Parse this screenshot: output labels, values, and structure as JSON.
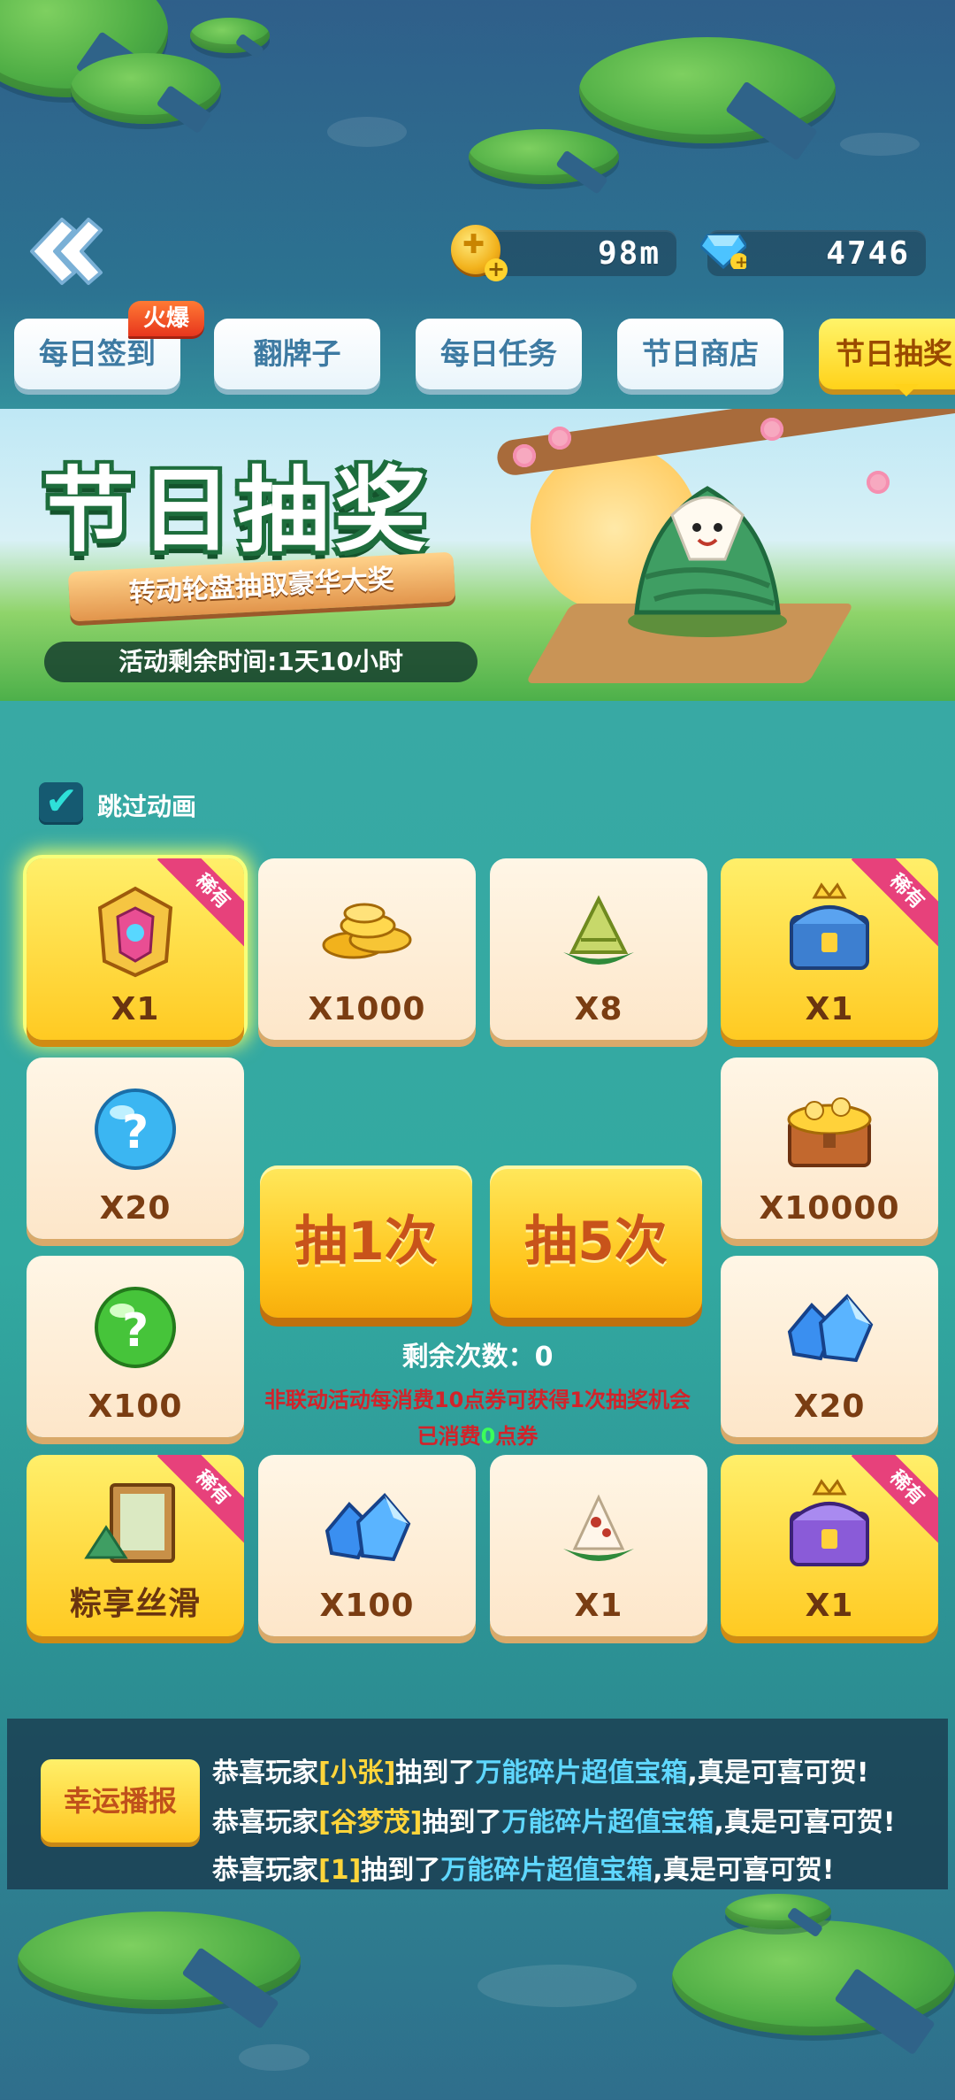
{
  "currency": {
    "coins": "98m",
    "gems": "4746"
  },
  "tabs": [
    {
      "label": "每日签到"
    },
    {
      "label": "翻牌子"
    },
    {
      "label": "每日任务"
    },
    {
      "label": "节日商店"
    },
    {
      "label": "节日抽奖"
    }
  ],
  "hot_badge": "火爆",
  "banner": {
    "title": "节日抽奖",
    "subtitle": "转动轮盘抽取豪华大奖",
    "time_left": "活动剩余时间:1天10小时"
  },
  "skip_animation": {
    "label": "跳过动画",
    "checked": true
  },
  "rare_tag": "稀有",
  "prizes": [
    {
      "qty": "X1",
      "rare": true
    },
    {
      "qty": "X1000",
      "rare": false
    },
    {
      "qty": "X8",
      "rare": false
    },
    {
      "qty": "X1",
      "rare": true
    },
    {
      "qty": "X20",
      "rare": false
    },
    {
      "qty": "X10000",
      "rare": false
    },
    {
      "qty": "X100",
      "rare": false
    },
    {
      "qty": "X20",
      "rare": false
    },
    {
      "qty": "粽享丝滑",
      "rare": true
    },
    {
      "qty": "X100",
      "rare": false
    },
    {
      "qty": "X1",
      "rare": false
    },
    {
      "qty": "X1",
      "rare": true
    }
  ],
  "draw": {
    "once": "抽1次",
    "five": "抽5次"
  },
  "remaining": {
    "label": "剩余次数：",
    "count": "0"
  },
  "note": {
    "line1": "非联动活动每消费10点券可获得1次抽奖机会",
    "spent_prefix": "已消费",
    "spent_value": "0",
    "spent_suffix": "点券"
  },
  "ticker": {
    "button": "幸运播报",
    "lines": [
      {
        "pre": "恭喜玩家",
        "name": "[小张]",
        "mid": "抽到了",
        "item": "万能碎片超值宝箱",
        "post": ",真是可喜可贺!"
      },
      {
        "pre": "恭喜玩家",
        "name": "[谷梦茂]",
        "mid": "抽到了",
        "item": "万能碎片超值宝箱",
        "post": ",真是可喜可贺!"
      },
      {
        "pre": "恭喜玩家",
        "name": "[1]",
        "mid": "抽到了",
        "item": "万能碎片超值宝箱",
        "post": ",真是可喜可贺!"
      }
    ]
  },
  "colors": {
    "accent_yellow": "#ffd21a",
    "tab_text": "#3d7aa2",
    "note_red": "#d2232a"
  }
}
